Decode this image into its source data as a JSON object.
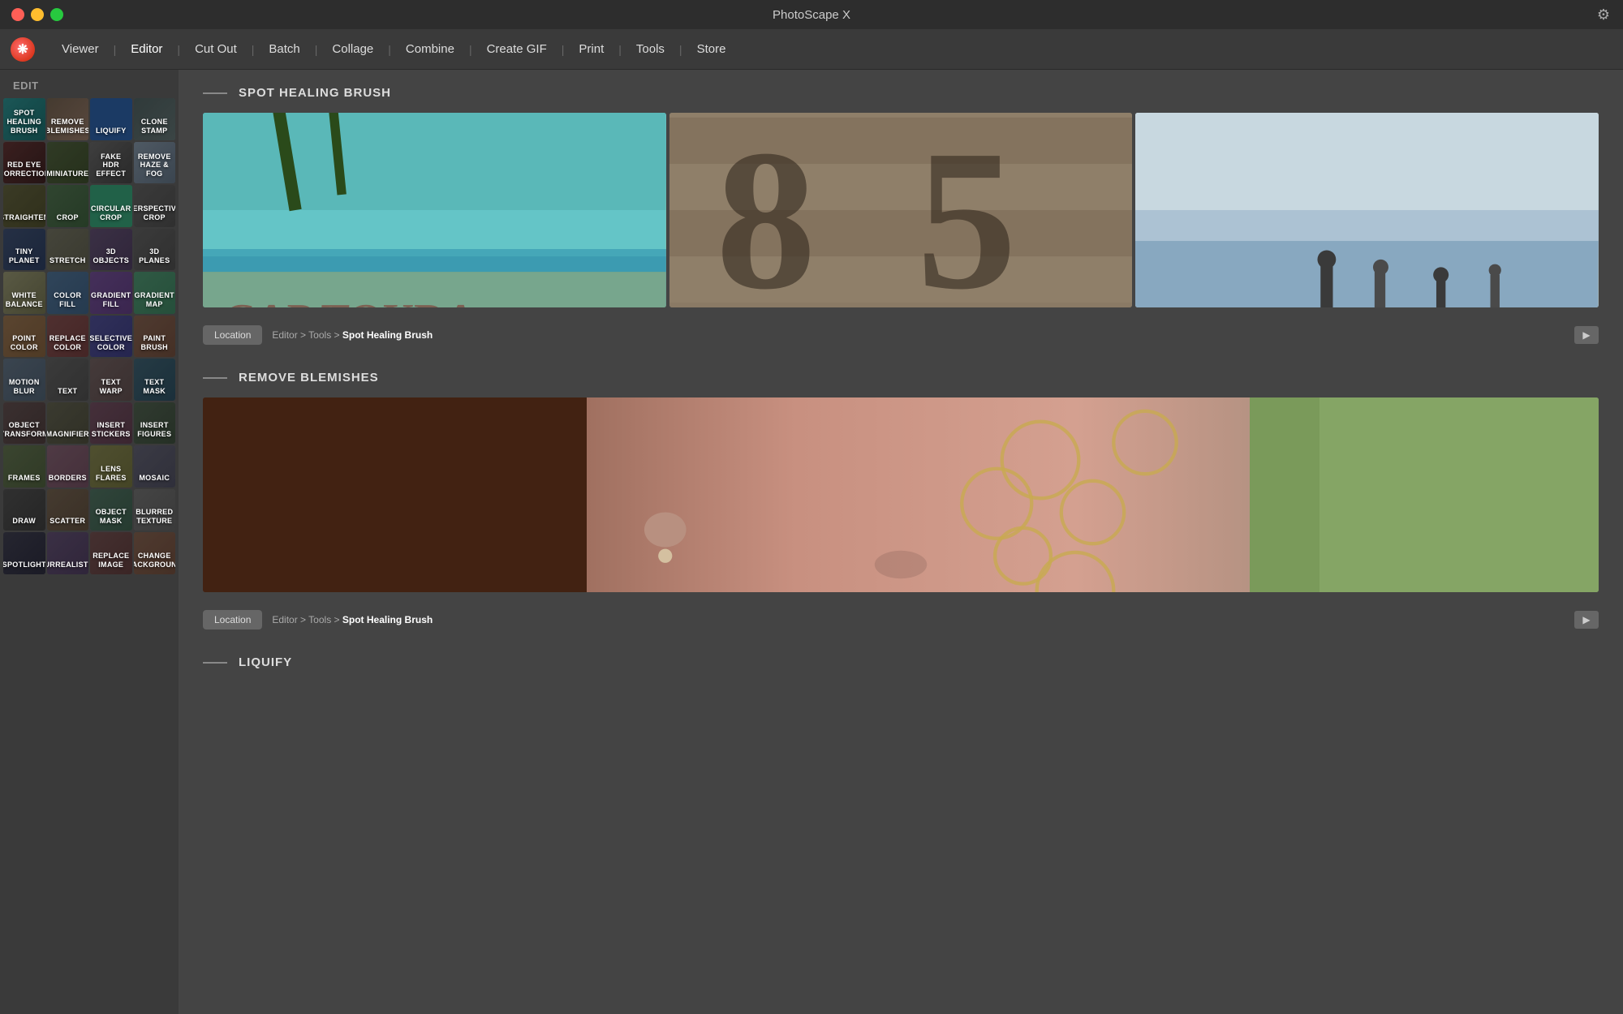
{
  "app": {
    "title": "PhotoScape X",
    "settings_icon": "⚙"
  },
  "titlebar": {
    "close_label": "",
    "minimize_label": "",
    "maximize_label": ""
  },
  "menu": {
    "items": [
      {
        "id": "viewer",
        "label": "Viewer"
      },
      {
        "id": "editor",
        "label": "Editor"
      },
      {
        "id": "cutout",
        "label": "Cut Out"
      },
      {
        "id": "batch",
        "label": "Batch"
      },
      {
        "id": "collage",
        "label": "Collage"
      },
      {
        "id": "combine",
        "label": "Combine"
      },
      {
        "id": "creategif",
        "label": "Create GIF"
      },
      {
        "id": "print",
        "label": "Print"
      },
      {
        "id": "tools",
        "label": "Tools"
      },
      {
        "id": "store",
        "label": "Store"
      }
    ]
  },
  "sidebar": {
    "edit_label": "EDIT",
    "tools": [
      {
        "id": "spot-healing",
        "label": "SPOT\nHEALING\nBRUSH",
        "class": "tile-palm"
      },
      {
        "id": "remove-blemishes",
        "label": "REMOVE\nBLEMISHES",
        "class": "tile-blemish"
      },
      {
        "id": "liquify",
        "label": "LIQUIFY",
        "class": "tile-liquify"
      },
      {
        "id": "clone-stamp",
        "label": "CLONE\nSTAMP",
        "class": "tile-clone"
      },
      {
        "id": "red-eye",
        "label": "RED EYE\nCORRECTION",
        "class": "tile-redeye"
      },
      {
        "id": "miniature",
        "label": "MINIATURE",
        "class": "tile-miniature"
      },
      {
        "id": "fake-hdr",
        "label": "FAKE\nHDR EFFECT",
        "class": "tile-hdrefx"
      },
      {
        "id": "remove-haze",
        "label": "REMOVE\nHAZE & FOG",
        "class": "tile-hazefog"
      },
      {
        "id": "straighten",
        "label": "STRAIGHTEN",
        "class": "tile-straighten"
      },
      {
        "id": "crop",
        "label": "CROP",
        "class": "tile-crop"
      },
      {
        "id": "circular-crop",
        "label": "CIRCULAR\nCROP",
        "class": "tile-circularcrop"
      },
      {
        "id": "perspective-crop",
        "label": "PERSPECTIVE\nCROP",
        "class": "tile-perspectivecrop"
      },
      {
        "id": "tiny-planet",
        "label": "TINY\nPLANET",
        "class": "tile-tinyplanet"
      },
      {
        "id": "stretch",
        "label": "STRETCH",
        "class": "tile-stretch"
      },
      {
        "id": "3d-objects",
        "label": "3D\nOBJECTS",
        "class": "tile-3dobjects"
      },
      {
        "id": "3d-planes",
        "label": "3D\nPLANES",
        "class": "tile-3dplanes"
      },
      {
        "id": "white-balance",
        "label": "WHITE\nBALANCE",
        "class": "tile-whitebal"
      },
      {
        "id": "color-fill",
        "label": "COLOR\nFILL",
        "class": "tile-colorfill"
      },
      {
        "id": "gradient-fill",
        "label": "GRADIENT\nFILL",
        "class": "tile-gradientfill"
      },
      {
        "id": "gradient-map",
        "label": "GRADIENT\nMAP",
        "class": "tile-gradientmap"
      },
      {
        "id": "point-color",
        "label": "POINT\nCOLOR",
        "class": "tile-pointcolor"
      },
      {
        "id": "replace-color",
        "label": "REPLACE\nCOLOR",
        "class": "tile-replacecolor"
      },
      {
        "id": "selective-color",
        "label": "SELECTIVE\nCOLOR",
        "class": "tile-selectivecolor"
      },
      {
        "id": "paint-brush",
        "label": "PAINT\nBRUSH",
        "class": "tile-paintbrush"
      },
      {
        "id": "motion-blur",
        "label": "MOTION\nBLUR",
        "class": "tile-motionblur"
      },
      {
        "id": "text",
        "label": "TEXT",
        "class": "tile-text"
      },
      {
        "id": "text-warp",
        "label": "TEXT\nWARP",
        "class": "tile-textwarp"
      },
      {
        "id": "text-mask",
        "label": "TEXT\nMASK",
        "class": "tile-textmask"
      },
      {
        "id": "object-transform",
        "label": "OBJECT\nTRANSFORM",
        "class": "tile-objecttransform"
      },
      {
        "id": "magnifier",
        "label": "MAGNIFIER",
        "class": "tile-magnifier"
      },
      {
        "id": "insert-stickers",
        "label": "INSERT\nSTICKERS",
        "class": "tile-insertstickers"
      },
      {
        "id": "insert-figures",
        "label": "INSERT\nFIGURES",
        "class": "tile-insertfigures"
      },
      {
        "id": "frames",
        "label": "FRAMES",
        "class": "tile-frames"
      },
      {
        "id": "borders",
        "label": "BORDERS",
        "class": "tile-borders"
      },
      {
        "id": "lens-flares",
        "label": "LENS\nFLARES",
        "class": "tile-lensflares"
      },
      {
        "id": "mosaic",
        "label": "MOSAIC",
        "class": "tile-mosaic"
      },
      {
        "id": "draw",
        "label": "DRAW",
        "class": "tile-draw"
      },
      {
        "id": "scatter",
        "label": "SCATTER",
        "class": "tile-scatter"
      },
      {
        "id": "object-mask",
        "label": "OBJECT\nMASK",
        "class": "tile-objectmask"
      },
      {
        "id": "blurred-texture",
        "label": "BLURRED\nTEXTURE",
        "class": "tile-blurredtexture"
      },
      {
        "id": "spotlight",
        "label": "SPOTLIGHT",
        "class": "tile-spotlight"
      },
      {
        "id": "surrealistic",
        "label": "SURREALISTIC",
        "class": "tile-surrealistic"
      },
      {
        "id": "replace-image",
        "label": "REPLACE\nIMAGE",
        "class": "tile-replaceimage"
      },
      {
        "id": "change-bg",
        "label": "CHANGE\nBACKGROUND",
        "class": "tile-changebg"
      }
    ]
  },
  "content": {
    "sections": [
      {
        "id": "spot-healing-brush",
        "title": "SPOT HEALING BRUSH",
        "location": {
          "btn": "Location",
          "path_prefix": "Editor > Tools > ",
          "path_suffix": "Spot Healing Brush"
        }
      },
      {
        "id": "remove-blemishes",
        "title": "REMOVE BLEMISHES",
        "location": {
          "btn": "Location",
          "path_prefix": "Editor > Tools > ",
          "path_suffix": "Spot Healing Brush"
        }
      },
      {
        "id": "liquify",
        "title": "LIQUIFY"
      }
    ]
  }
}
